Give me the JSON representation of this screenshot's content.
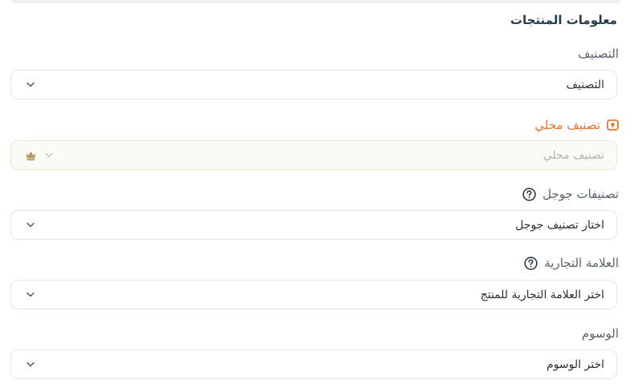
{
  "section": {
    "title": "معلومات المنتجات"
  },
  "fields": {
    "category": {
      "label": "التصنيف",
      "value": "التصنيف"
    },
    "local_category": {
      "label": "تصنيف محلي",
      "placeholder": "تصنيف محلي"
    },
    "google_categories": {
      "label": "تصنيفات جوجل",
      "value": "اختار تصنيف جوجل"
    },
    "brand": {
      "label": "العلامة التجارية",
      "value": "اختر العلامة التجارية للمنتج"
    },
    "tags": {
      "label": "الوسوم",
      "value": "اختر الوسوم"
    }
  },
  "icons": {
    "help": "question-circle-icon",
    "warning": "warning-badge-icon",
    "premium": "crown-icon",
    "dropdown": "chevron-down-icon"
  },
  "colors": {
    "title": "#1f3b4f",
    "label": "#5a6470",
    "warning": "#e8742e",
    "premium": "#b59a62",
    "border": "#e4e7ea"
  }
}
